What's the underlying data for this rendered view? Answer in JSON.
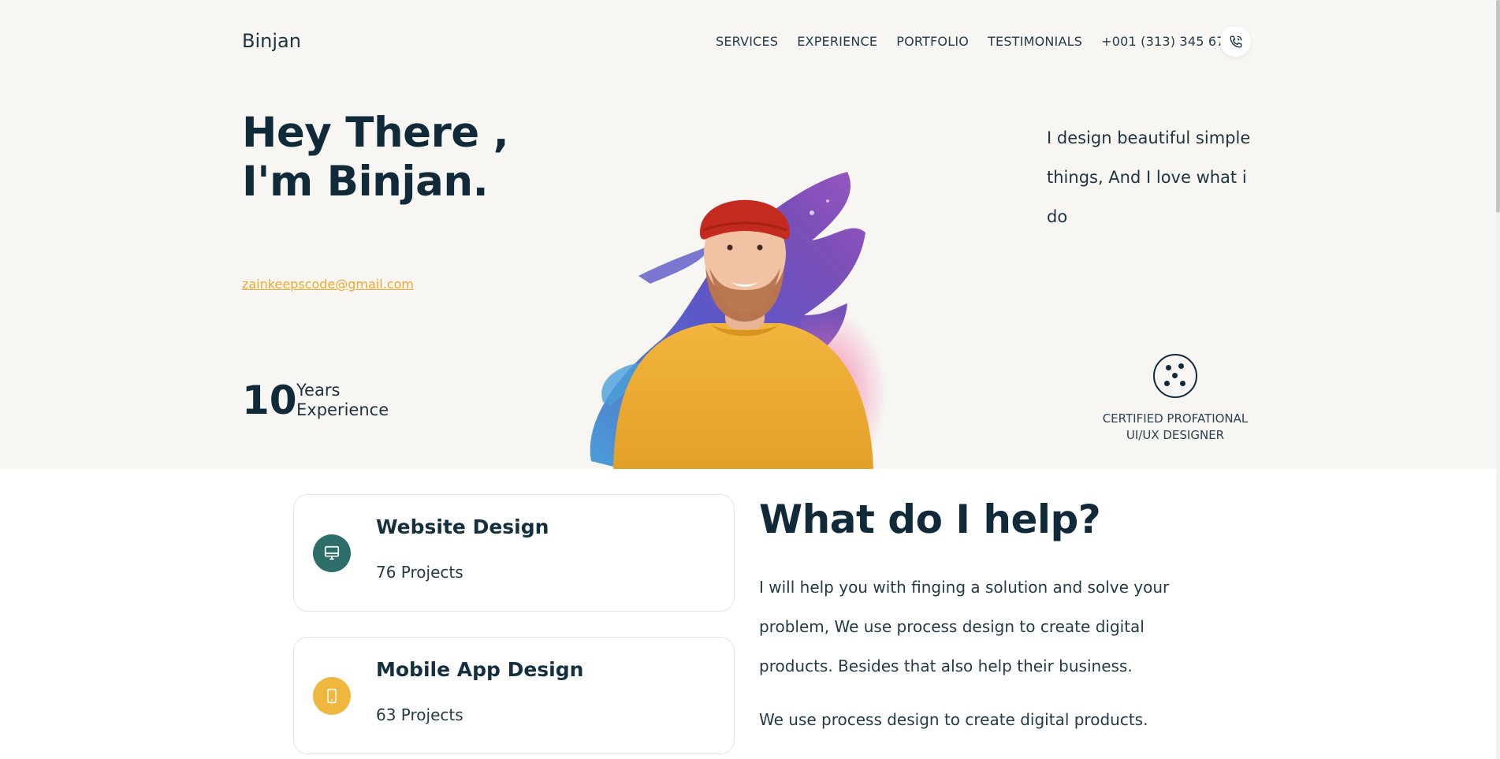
{
  "brand": "Binjan",
  "nav": {
    "items": [
      "SERVICES",
      "EXPERIENCE",
      "PORTFOLIO",
      "TESTIMONIALS",
      "+001 (313) 345 678"
    ],
    "phone_icon": "phone-icon"
  },
  "hero": {
    "title_line1": "Hey There ,",
    "title_line2": "I'm Binjan.",
    "email": "zainkeepscode@gmail.com",
    "years_number": "10",
    "years_label_line1": "Years",
    "years_label_line2": "Experience",
    "tagline_line1": "I design beautiful simple",
    "tagline_line2": "things, And I love what i do",
    "cert_line1": "CERTIFIED PROFATIONAL",
    "cert_line2": "UI/UX DESIGNER"
  },
  "services": [
    {
      "title": "Website Design",
      "count": "76 Projects",
      "icon": "monitor-icon",
      "color": "#2e6e6a"
    },
    {
      "title": "Mobile App Design",
      "count": "63 Projects",
      "icon": "mobile-icon",
      "color": "#f0b73f"
    }
  ],
  "help": {
    "title": "What do I help?",
    "p1_line1": "I will help you with finging a solution and solve your",
    "p1_line2": "problem, We use process design to create digital",
    "p1_line3": "products. Besides that also help their business.",
    "p2": "We use process design to create digital products."
  },
  "colors": {
    "hero_bg": "#f7f6f2",
    "navy": "#112a3a",
    "accent_orange": "#f0a830",
    "teal": "#2e6e6a",
    "yellow": "#f0b73f"
  }
}
